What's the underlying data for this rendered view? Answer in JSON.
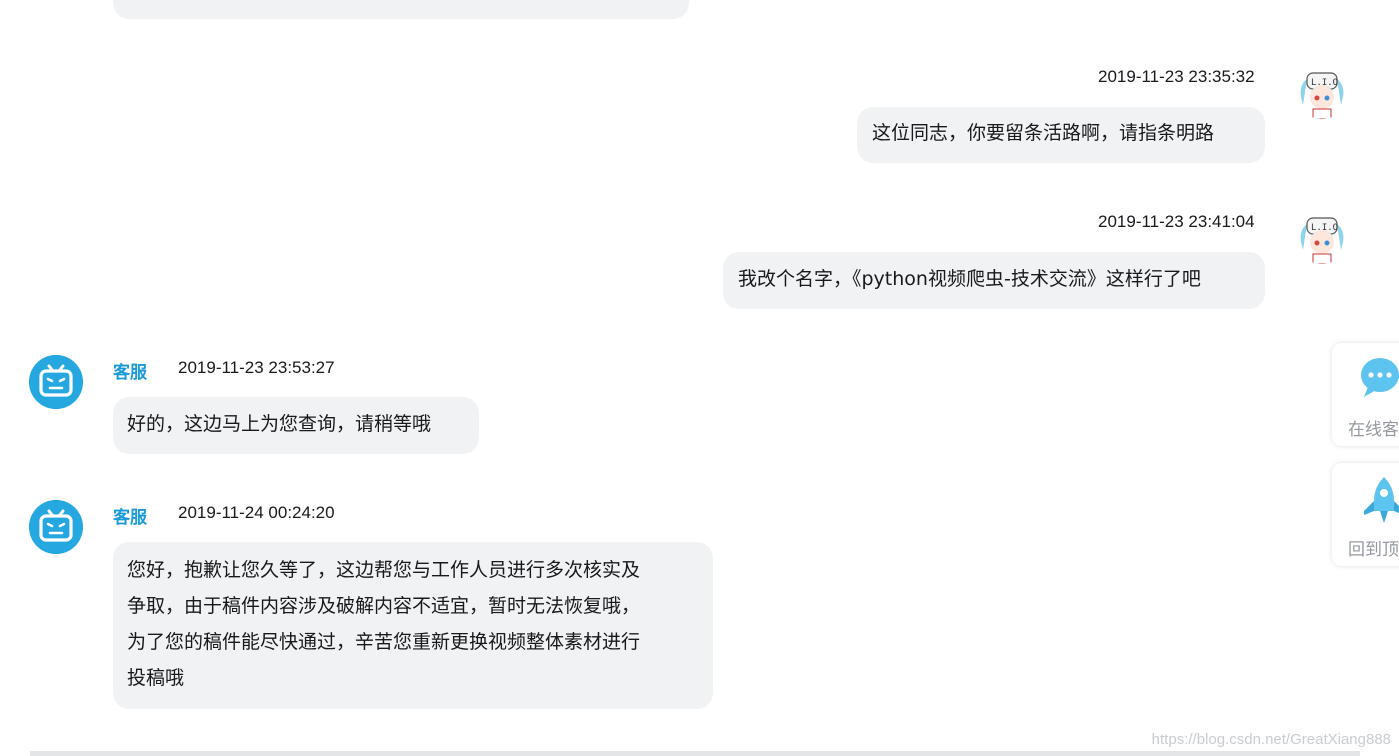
{
  "messages": [
    {
      "time": "2019-11-23 23:35:32",
      "text": "这位同志，你要留条活路啊，请指条明路"
    },
    {
      "time": "2019-11-23 23:41:04",
      "text": "我改个名字，《python视频爬虫-技术交流》这样行了吧"
    },
    {
      "sender": "客服",
      "time": "2019-11-23 23:53:27",
      "text": "好的，这边马上为您查询，请稍等哦"
    },
    {
      "sender": "客服",
      "time": "2019-11-24 00:24:20",
      "lines": [
        "您好，抱歉让您久等了，这边帮您与工作人员进行多次核实及",
        "争取，由于稿件内容涉及破解内容不适宜，暂时无法恢复哦，",
        "为了您的稿件能尽快通过，辛苦您重新更换视频整体素材进行",
        "投稿哦"
      ]
    }
  ],
  "sidebar": {
    "online_service_label": "在线客",
    "back_to_top_label": "回到顶"
  },
  "watermark": "https://blog.csdn.net/GreatXiang888",
  "colors": {
    "accent": "#1a9bd7",
    "bubble_bg": "#f1f2f3"
  },
  "icons": [
    "bilibili-tv-icon",
    "user-avatar-icon",
    "chat-bubble-icon",
    "rocket-icon"
  ]
}
